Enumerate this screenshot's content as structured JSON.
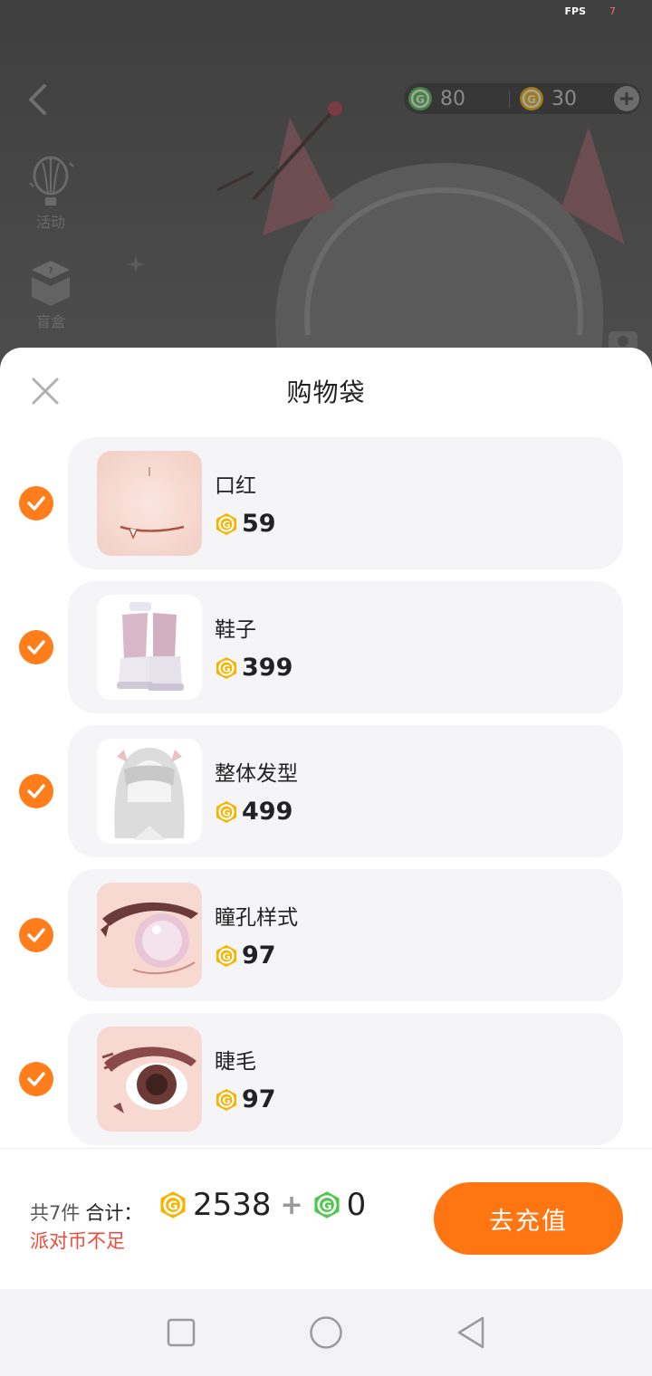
{
  "status": {
    "fps_label": "FPS",
    "fps_value": "7"
  },
  "topbar": {
    "green_coin_balance": "80",
    "gold_coin_balance": "30"
  },
  "side_menu": [
    {
      "label": "活动",
      "icon": "hot-air-balloon-icon"
    },
    {
      "label": "盲盒",
      "icon": "blind-box-icon"
    }
  ],
  "sheet": {
    "title": "购物袋",
    "items": [
      {
        "name": "口红",
        "price": "59",
        "checked": true,
        "thumb": "lipstick-thumbnail"
      },
      {
        "name": "鞋子",
        "price": "399",
        "checked": true,
        "thumb": "shoes-thumbnail"
      },
      {
        "name": "整体发型",
        "price": "499",
        "checked": true,
        "thumb": "hairstyle-thumbnail"
      },
      {
        "name": "瞳孔样式",
        "price": "97",
        "checked": true,
        "thumb": "pupil-style-thumbnail"
      },
      {
        "name": "睫毛",
        "price": "97",
        "checked": true,
        "thumb": "eyelashes-thumbnail"
      }
    ]
  },
  "footer": {
    "count_text": "共7件",
    "total_label": "合计：",
    "gold_total": "2538",
    "plus": "+",
    "green_total": "0",
    "warning": "派对币不足",
    "recharge_label": "去充值"
  },
  "colors": {
    "accent": "#ff7512",
    "check": "#ff7d1a",
    "warning": "#f04a3a",
    "gold_coin": "#f5b400",
    "green_coin": "#4cc94a"
  }
}
